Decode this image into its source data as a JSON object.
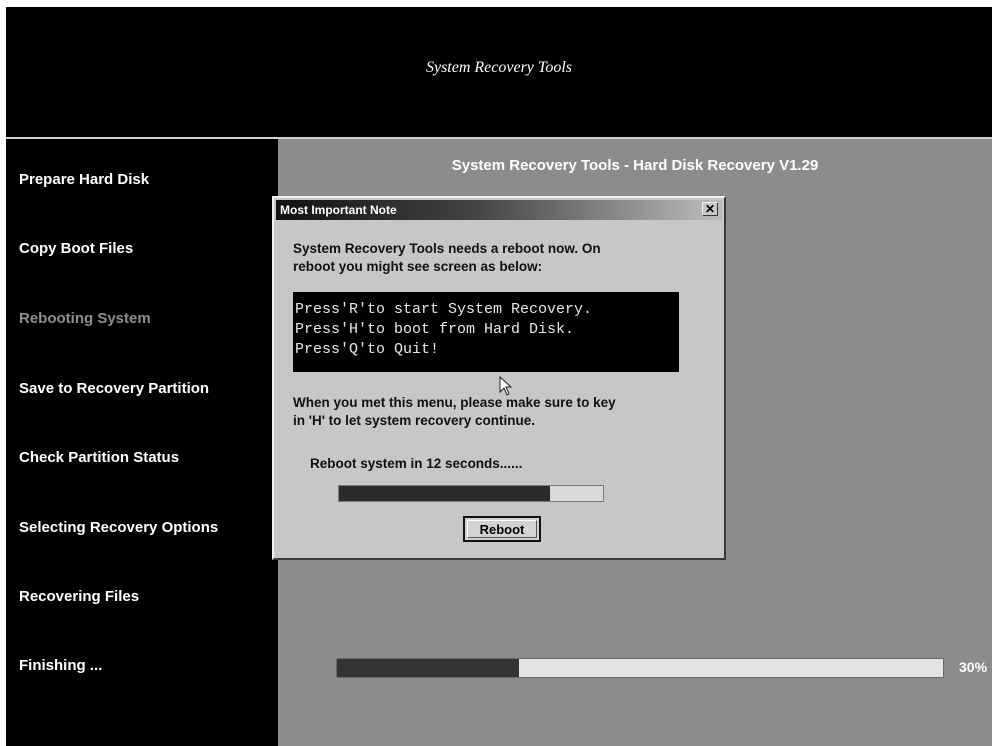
{
  "banner": {
    "title": "System Recovery Tools"
  },
  "sidebar": {
    "steps": [
      {
        "label": "Prepare Hard Disk",
        "state": "done"
      },
      {
        "label": "Copy Boot Files",
        "state": "done"
      },
      {
        "label": "Rebooting System",
        "state": "current"
      },
      {
        "label": "Save to Recovery Partition",
        "state": "pending"
      },
      {
        "label": "Check Partition Status",
        "state": "pending"
      },
      {
        "label": "Selecting Recovery Options",
        "state": "pending"
      },
      {
        "label": "Recovering Files",
        "state": "pending"
      },
      {
        "label": "Finishing ...",
        "state": "pending"
      }
    ]
  },
  "main": {
    "title": "System Recovery Tools - Hard Disk Recovery V1.29",
    "progress_percent": 30,
    "progress_label": "30%"
  },
  "dialog": {
    "title": "Most Important Note",
    "close_glyph": "✕",
    "message_line1": "System Recovery Tools needs a reboot now. On",
    "message_line2": "reboot you might see screen as below:",
    "console_lines": [
      "Press'R'to start System Recovery.",
      "Press'H'to boot from Hard Disk.",
      "Press'Q'to Quit!"
    ],
    "instruction_line1": "When you met this menu, please make sure to key",
    "instruction_line2": "in 'H' to let system recovery continue.",
    "countdown": "Reboot system in 12 seconds......",
    "countdown_progress_fraction": 0.8,
    "reboot_label": "Reboot"
  },
  "colors": {
    "background": "#000000",
    "main_panel": "#8c8c8c",
    "dialog_face": "#c7c7c7",
    "text_light": "#ffffff",
    "step_dim": "#8e8e8e"
  }
}
